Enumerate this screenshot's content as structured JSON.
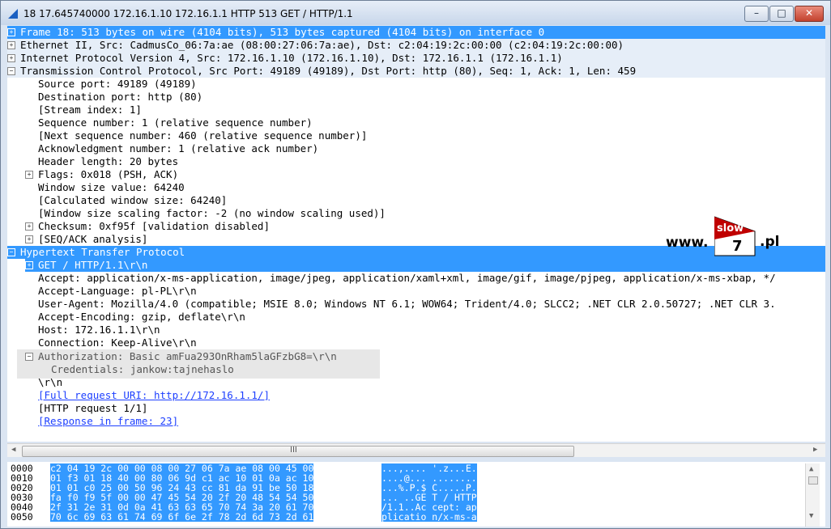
{
  "window": {
    "title": "18 17.645740000 172.16.1.10 172.16.1.1 HTTP 513 GET / HTTP/1.1"
  },
  "tree": {
    "frame": "Frame 18: 513 bytes on wire (4104 bits), 513 bytes captured (4104 bits) on interface 0",
    "ethernet": "Ethernet II, Src: CadmusCo_06:7a:ae (08:00:27:06:7a:ae), Dst: c2:04:19:2c:00:00 (c2:04:19:2c:00:00)",
    "ip": "Internet Protocol Version 4, Src: 172.16.1.10 (172.16.1.10), Dst: 172.16.1.1 (172.16.1.1)",
    "tcp": "Transmission Control Protocol, Src Port: 49189 (49189), Dst Port: http (80), Seq: 1, Ack: 1, Len: 459",
    "tcp_fields": [
      "Source port: 49189 (49189)",
      "Destination port: http (80)",
      "[Stream index: 1]",
      "Sequence number: 1    (relative sequence number)",
      "[Next sequence number: 460    (relative sequence number)]",
      "Acknowledgment number: 1    (relative ack number)",
      "Header length: 20 bytes",
      "Flags: 0x018 (PSH, ACK)",
      "Window size value: 64240",
      "[Calculated window size: 64240]",
      "[Window size scaling factor: -2 (no window scaling used)]",
      "Checksum: 0xf95f [validation disabled]",
      "[SEQ/ACK analysis]"
    ],
    "http": "Hypertext Transfer Protocol",
    "http_fields": [
      "GET / HTTP/1.1\\r\\n",
      "Accept: application/x-ms-application, image/jpeg, application/xaml+xml, image/gif, image/pjpeg, application/x-ms-xbap, */",
      "Accept-Language: pl-PL\\r\\n",
      "User-Agent: Mozilla/4.0 (compatible; MSIE 8.0; Windows NT 6.1; WOW64; Trident/4.0; SLCC2; .NET CLR 2.0.50727; .NET CLR 3.",
      "Accept-Encoding: gzip, deflate\\r\\n",
      "Host: 172.16.1.1\\r\\n",
      "Connection: Keep-Alive\\r\\n",
      "Authorization: Basic amFua293OnRham5laGFzbG8=\\r\\n",
      "Credentials: jankow:tajnehaslo",
      "\\r\\n",
      "[Full request URI: http://172.16.1.1/]",
      "[HTTP request 1/1]",
      "[Response in frame: 23]"
    ]
  },
  "logo": {
    "www": "www.",
    "word": "slow",
    "digit": "7",
    "tld": ".pl"
  },
  "hscroll": {
    "grip": "III"
  },
  "hex": [
    {
      "offset": "0000",
      "bytes": "c2 04 19 2c 00 00 08 00  27 06 7a ae 08 00 45 00",
      "ascii": "...,....  '.z...E."
    },
    {
      "offset": "0010",
      "bytes": "01 f3 01 18 40 00 80 06  9d c1 ac 10 01 0a ac 10",
      "ascii": "....@... ........"
    },
    {
      "offset": "0020",
      "bytes": "01 01 c0 25 00 50 96 24  43 cc 81 da 91 be 50 18",
      "ascii": "...%.P.$ C.....P."
    },
    {
      "offset": "0030",
      "bytes": "fa f0 f9 5f 00 00 47 45  54 20 2f 20 48 54 54 50",
      "ascii": "..._..GE T / HTTP"
    },
    {
      "offset": "0040",
      "bytes": "2f 31 2e 31 0d 0a 41 63  63 65 70 74 3a 20 61 70",
      "ascii": "/1.1..Ac cept: ap"
    },
    {
      "offset": "0050",
      "bytes": "70 6c 69 63 61 74 69 6f  6e 2f 78 2d 6d 73 2d 61",
      "ascii": "plicatio n/x-ms-a"
    }
  ],
  "colors": {
    "selection": "#3399ff",
    "link": "#1e40ff"
  }
}
